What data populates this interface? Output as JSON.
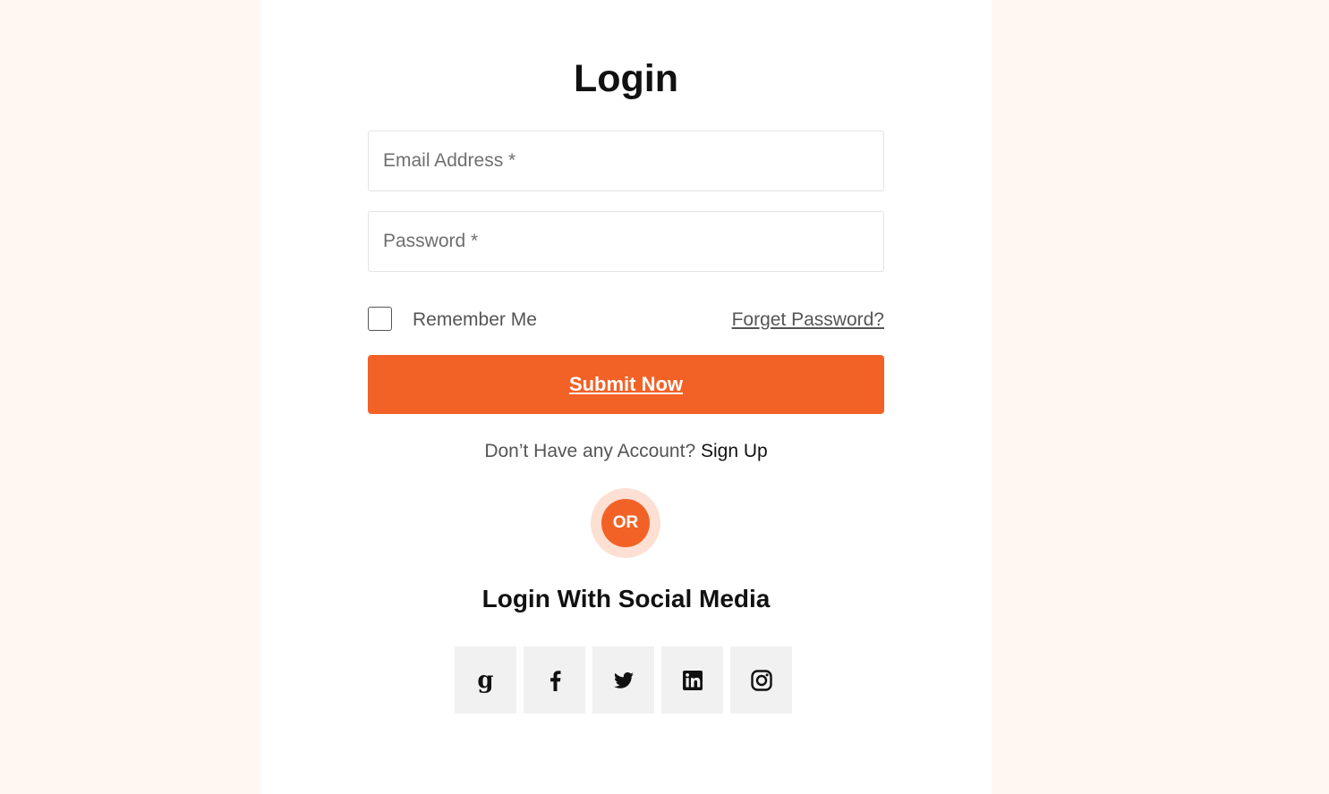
{
  "login": {
    "title": "Login",
    "email_placeholder": "Email Address *",
    "password_placeholder": "Password *",
    "remember_label": "Remember Me",
    "remember_checked": false,
    "forgot_label": "Forget Password?",
    "submit_label": "Submit Now",
    "signup_prompt": "Don’t Have any Account?",
    "signup_link": "Sign Up",
    "or_label": "OR",
    "social_title": "Login With Social Media",
    "social_buttons": [
      "google-icon",
      "facebook-icon",
      "twitter-icon",
      "linkedin-icon",
      "instagram-icon"
    ]
  },
  "colors": {
    "background": "#fff7f1",
    "card": "#ffffff",
    "accent": "#f26226",
    "accent_light": "#fde0d3",
    "social_button_bg": "#f1f1f1"
  }
}
